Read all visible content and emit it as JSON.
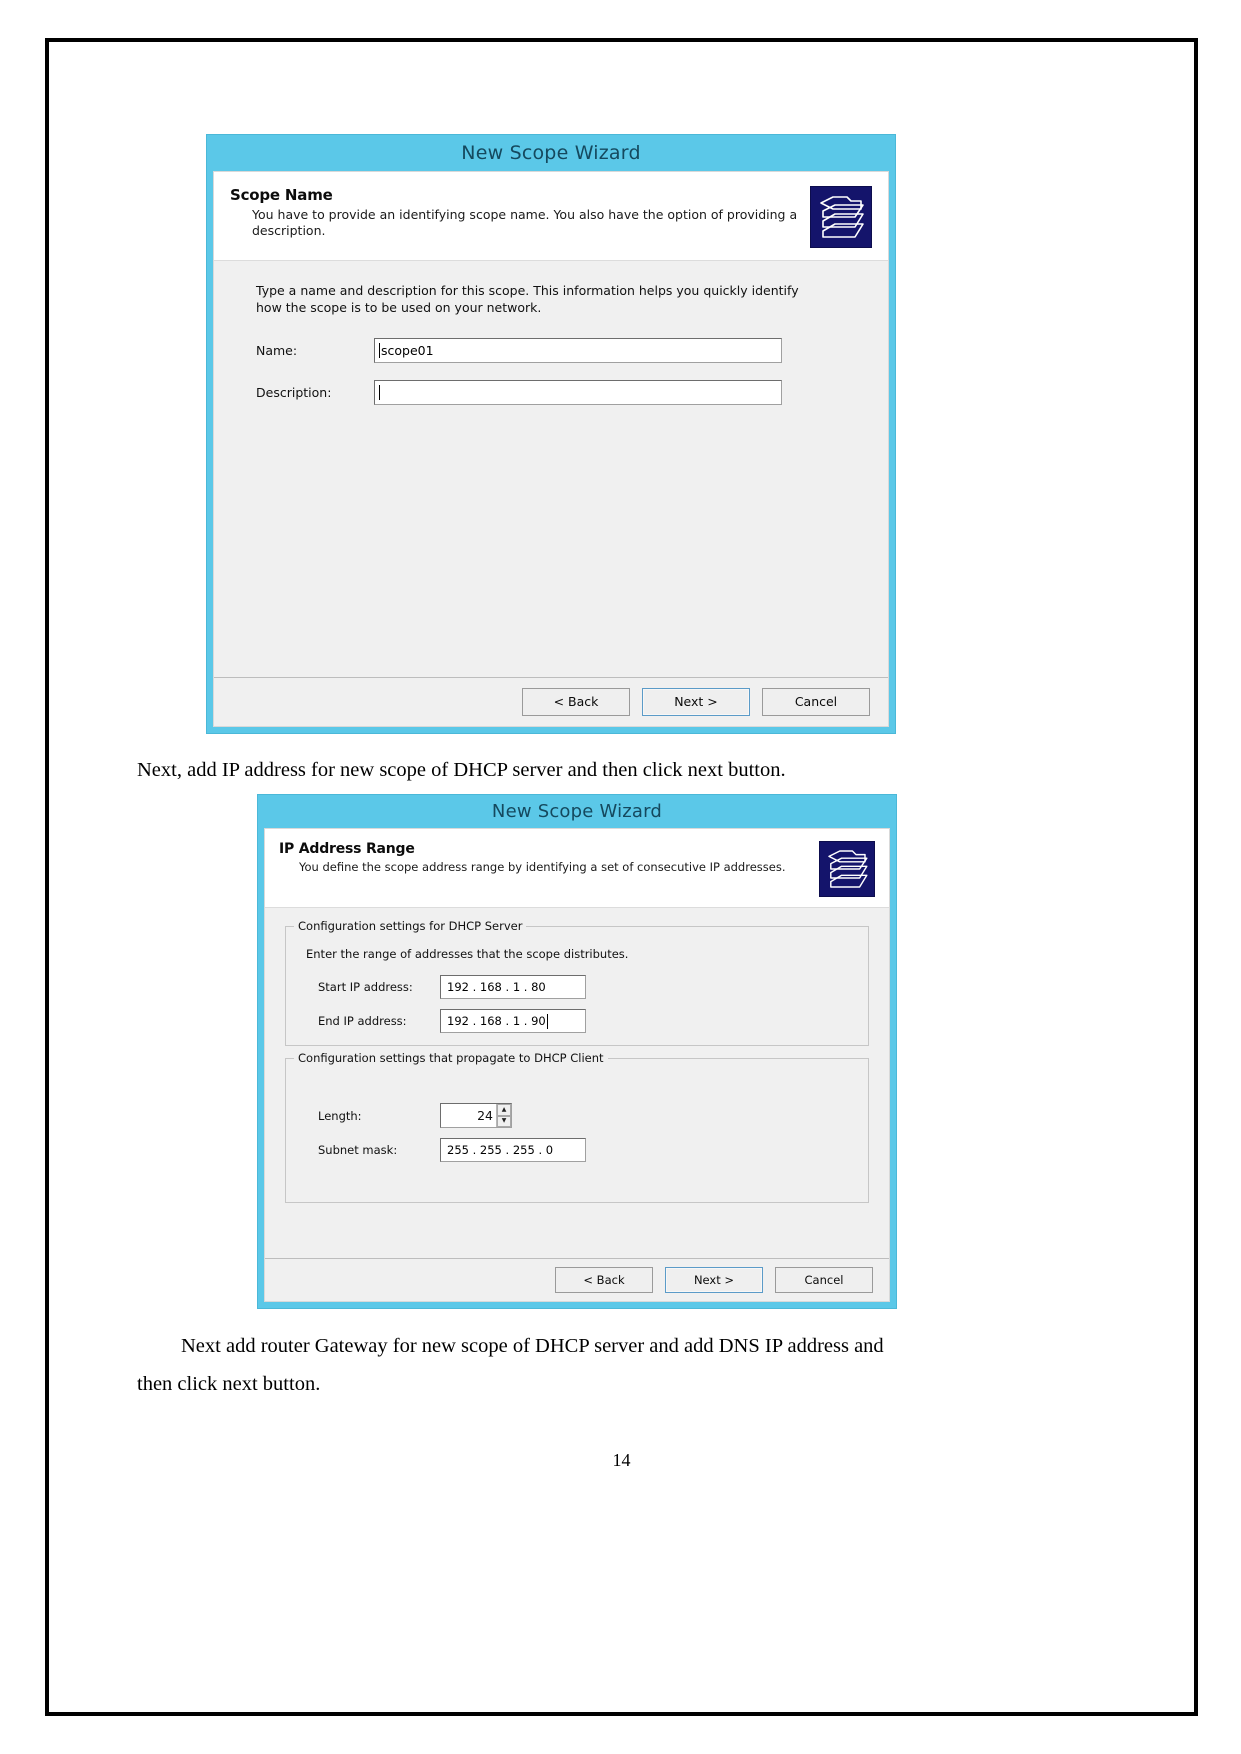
{
  "document": {
    "page_number": "14",
    "paragraph_1": "Next, add IP address for new scope of DHCP server and then click next button.",
    "paragraph_2_line1": "Next add router Gateway for new scope of DHCP server and add DNS IP address and",
    "paragraph_2_line2": "then click next button."
  },
  "colors": {
    "title_bar": "#5bc8e8",
    "dialog_body": "#f0f0f0",
    "icon_background": "#14146b",
    "default_button_border": "#5b9bc8"
  },
  "dialog1": {
    "title": "New Scope Wizard",
    "heading": "Scope Name",
    "subheading": "You have to provide an identifying scope name. You also have the option of providing a description.",
    "icon": "folder-stack-icon",
    "intro_line1": "Type a name and description for this scope. This information helps you quickly identify",
    "intro_line2": "how the scope is to be used on your network.",
    "fields": [
      {
        "label": "Name:",
        "value": "scope01",
        "caret": "before"
      },
      {
        "label": "Description:",
        "value": "",
        "caret": "before"
      }
    ],
    "buttons": [
      {
        "label": "< Back",
        "default": false
      },
      {
        "label": "Next >",
        "default": true
      },
      {
        "label": "Cancel",
        "default": false
      }
    ]
  },
  "dialog2": {
    "title": "New Scope Wizard",
    "heading": "IP Address Range",
    "subheading": "You define the scope address range by identifying a set of consecutive IP addresses.",
    "icon": "folder-stack-icon",
    "group_server": {
      "title": "Configuration settings for DHCP Server",
      "intro": "Enter the range of addresses that the scope distributes.",
      "fields": [
        {
          "label": "Start IP address:",
          "value": "192 . 168 .  1  .  80",
          "caret": false
        },
        {
          "label": "End IP address:",
          "value": "192 . 168 .  1  .  90",
          "caret": true
        }
      ]
    },
    "group_client": {
      "title": "Configuration settings that propagate to DHCP Client",
      "length_label": "Length:",
      "length_value": "24",
      "subnet_label": "Subnet mask:",
      "subnet_value": "255 . 255 . 255 .   0"
    },
    "buttons": [
      {
        "label": "< Back",
        "default": false
      },
      {
        "label": "Next >",
        "default": true
      },
      {
        "label": "Cancel",
        "default": false
      }
    ]
  }
}
